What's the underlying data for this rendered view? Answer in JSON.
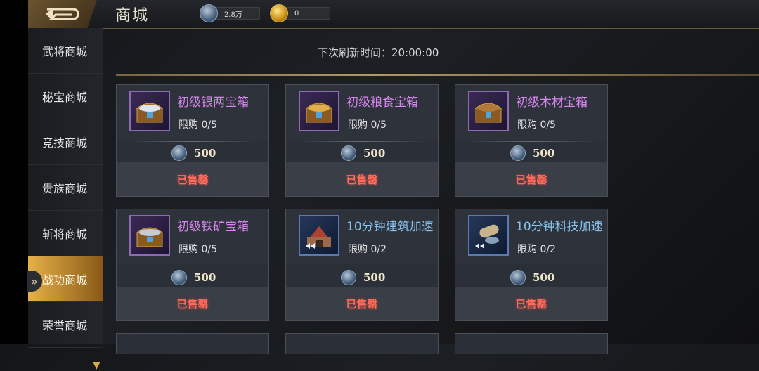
{
  "header": {
    "title": "商城",
    "resources": [
      {
        "icon": "silver-coin-icon",
        "value": "2.8万"
      },
      {
        "icon": "gold-coin-icon",
        "value": "0"
      }
    ]
  },
  "sidebar": {
    "items": [
      {
        "label": "武将商城",
        "active": false
      },
      {
        "label": "秘宝商城",
        "active": false
      },
      {
        "label": "竞技商城",
        "active": false
      },
      {
        "label": "贵族商城",
        "active": false
      },
      {
        "label": "斩将商城",
        "active": false
      },
      {
        "label": "战功商城",
        "active": true
      },
      {
        "label": "荣誉商城",
        "active": false
      }
    ]
  },
  "refresh": {
    "text": "下次刷新时间：20:00:00"
  },
  "items": [
    {
      "name": "初级银两宝箱",
      "limit": "限购  0/5",
      "price": "500",
      "status": "已售罄",
      "icon": "treasure-chest-silver-icon"
    },
    {
      "name": "初级粮食宝箱",
      "limit": "限购  0/5",
      "price": "500",
      "status": "已售罄",
      "icon": "treasure-chest-food-icon"
    },
    {
      "name": "初级木材宝箱",
      "limit": "限购  0/5",
      "price": "500",
      "status": "已售罄",
      "icon": "treasure-chest-wood-icon"
    },
    {
      "name": "初级铁矿宝箱",
      "limit": "限购  0/5",
      "price": "500",
      "status": "已售罄",
      "icon": "treasure-chest-iron-icon"
    },
    {
      "name": "10分钟建筑加速",
      "limit": "限购  0/2",
      "price": "500",
      "status": "已售罄",
      "icon": "building-speedup-icon"
    },
    {
      "name": "10分钟科技加速",
      "limit": "限购  0/2",
      "price": "500",
      "status": "已售罄",
      "icon": "tech-speedup-icon"
    }
  ],
  "colors": {
    "accent": "#e6b04a",
    "soldout": "#ff6a5a",
    "chest_name": "#d887f0",
    "speedup_name": "#86c3ef"
  }
}
